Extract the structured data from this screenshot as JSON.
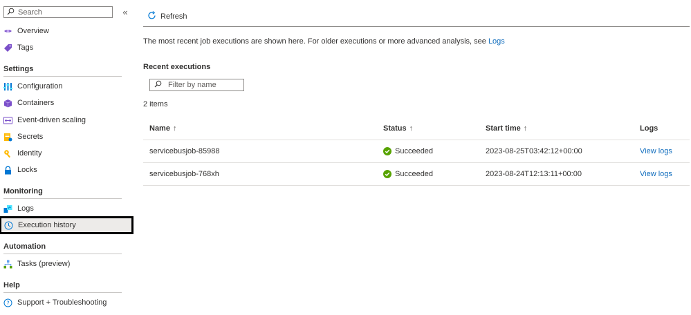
{
  "sidebar": {
    "search_placeholder": "Search",
    "collapse_glyph": "«",
    "items_top": [
      {
        "label": "Overview",
        "icon": "overview-icon"
      },
      {
        "label": "Tags",
        "icon": "tag-icon"
      }
    ],
    "sections": [
      {
        "header": "Settings",
        "items": [
          {
            "label": "Configuration",
            "icon": "configuration-icon"
          },
          {
            "label": "Containers",
            "icon": "containers-icon"
          },
          {
            "label": "Event-driven scaling",
            "icon": "scaling-icon"
          },
          {
            "label": "Secrets",
            "icon": "secrets-icon"
          },
          {
            "label": "Identity",
            "icon": "identity-icon"
          },
          {
            "label": "Locks",
            "icon": "lock-icon"
          }
        ]
      },
      {
        "header": "Monitoring",
        "items": [
          {
            "label": "Logs",
            "icon": "logs-icon"
          },
          {
            "label": "Execution history",
            "icon": "clock-icon",
            "selected": true
          }
        ]
      },
      {
        "header": "Automation",
        "items": [
          {
            "label": "Tasks (preview)",
            "icon": "tasks-icon"
          }
        ]
      },
      {
        "header": "Help",
        "items": [
          {
            "label": "Support + Troubleshooting",
            "icon": "help-icon"
          }
        ]
      }
    ]
  },
  "toolbar": {
    "refresh_label": "Refresh"
  },
  "main": {
    "info_text": "The most recent job executions are shown here. For older executions or more advanced analysis, see",
    "info_link": "Logs",
    "recent_title": "Recent executions",
    "filter_placeholder": "Filter by name",
    "count": "2 items",
    "table": {
      "headers": {
        "name": "Name",
        "status": "Status",
        "start_time": "Start time",
        "logs": "Logs"
      },
      "sort_glyph": "↑",
      "rows": [
        {
          "name": "servicebusjob-85988",
          "status": "Succeeded",
          "start_time": "2023-08-25T03:42:12+00:00",
          "logs": "View logs"
        },
        {
          "name": "servicebusjob-768xh",
          "status": "Succeeded",
          "start_time": "2023-08-24T12:13:11+00:00",
          "logs": "View logs"
        }
      ]
    }
  },
  "colors": {
    "accent": "#0f6cbd",
    "success": "#57a300",
    "selected_bg": "#edebe9",
    "selection_outline": "#000000"
  }
}
